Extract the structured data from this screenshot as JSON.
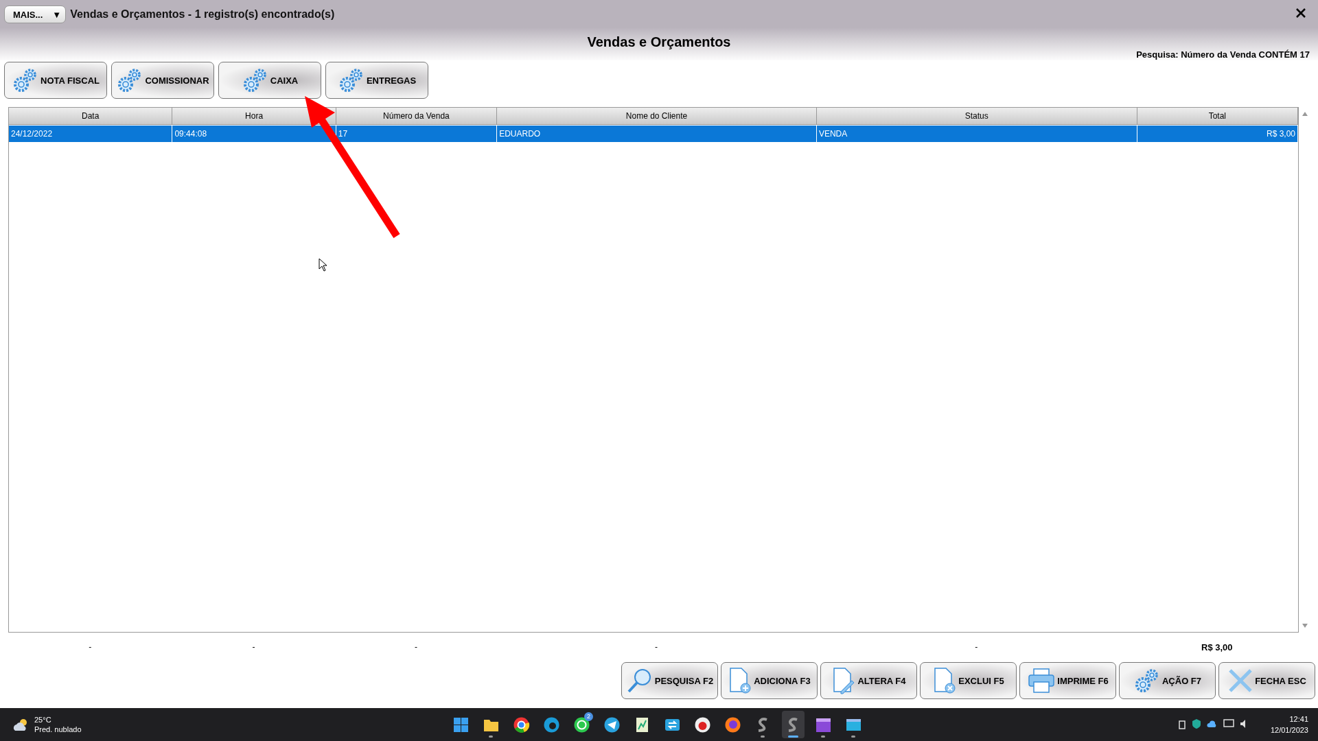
{
  "window": {
    "menu_button": "MAIS...",
    "menu_caret": "▼",
    "title": "Vendas e Orçamentos - 1 registro(s) encontrado(s)"
  },
  "header": {
    "title": "Vendas e Orçamentos",
    "search_info": "Pesquisa: Número da Venda CONTÉM 17"
  },
  "actions": [
    {
      "label": "NOTA FISCAL",
      "kind": "gear"
    },
    {
      "label": "COMISSIONAR",
      "kind": "gear"
    },
    {
      "label": "CAIXA",
      "kind": "gear"
    },
    {
      "label": "ENTREGAS",
      "kind": "gear"
    }
  ],
  "table": {
    "columns": [
      "Data",
      "Hora",
      "Número da Venda",
      "Nome do Cliente",
      "Status",
      "Total"
    ],
    "rows": [
      {
        "selected": true,
        "cells": [
          "24/12/2022",
          "09:44:08",
          "17",
          "EDUARDO",
          "VENDA",
          "R$ 3,00"
        ]
      }
    ],
    "totals": [
      "-",
      "-",
      "-",
      "-",
      "-",
      "R$ 3,00"
    ]
  },
  "footer_buttons": [
    {
      "label": "PESQUISA F2",
      "kind": "search"
    },
    {
      "label": "ADICIONA F3",
      "kind": "add"
    },
    {
      "label": "ALTERA F4",
      "kind": "edit"
    },
    {
      "label": "EXCLUI F5",
      "kind": "delete"
    },
    {
      "label": "IMPRIME F6",
      "kind": "print"
    },
    {
      "label": "AÇÃO F7",
      "kind": "gear"
    },
    {
      "label": "FECHA ESC",
      "kind": "close"
    }
  ],
  "taskbar": {
    "weather": {
      "temperature": "25°C",
      "condition": "Pred. nublado"
    },
    "apps": [
      {
        "running": false,
        "selected": false
      },
      {
        "running": true,
        "selected": false
      },
      {
        "running": false,
        "selected": false
      },
      {
        "running": false,
        "selected": false
      },
      {
        "running": false,
        "selected": false,
        "badge": "2"
      },
      {
        "running": false,
        "selected": false
      },
      {
        "running": false,
        "selected": false
      },
      {
        "running": false,
        "selected": false
      },
      {
        "running": false,
        "selected": false
      },
      {
        "running": false,
        "selected": false
      },
      {
        "running": true,
        "selected": false
      },
      {
        "running": true,
        "selected": true
      },
      {
        "running": true,
        "selected": false
      },
      {
        "running": true,
        "selected": false
      }
    ],
    "clock": {
      "time": "12:41",
      "date": "12/01/2023"
    }
  }
}
